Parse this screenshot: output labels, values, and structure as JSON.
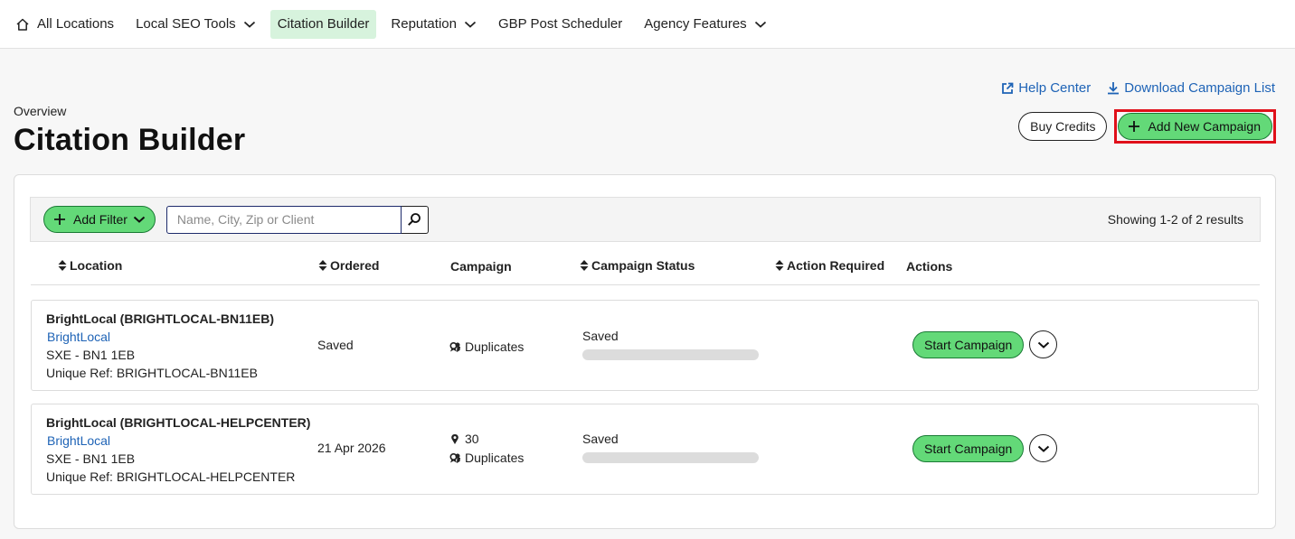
{
  "nav": {
    "items": [
      {
        "label": "All Locations",
        "icon": "home-icon"
      },
      {
        "label": "Local SEO Tools",
        "icon": "chevron-down-icon"
      },
      {
        "label": "Citation Builder"
      },
      {
        "label": "Reputation",
        "icon": "chevron-down-icon"
      },
      {
        "label": "GBP Post Scheduler"
      },
      {
        "label": "Agency Features",
        "icon": "chevron-down-icon"
      }
    ],
    "active": "Citation Builder"
  },
  "header": {
    "overview": "Overview",
    "title": "Citation Builder",
    "help_center": "Help Center",
    "download_list": "Download Campaign List",
    "buy_credits": "Buy Credits",
    "add_campaign": "Add New Campaign"
  },
  "filters": {
    "add_filter": "Add Filter",
    "search_placeholder": "Name, City, Zip or Client",
    "results": "Showing 1-2 of 2 results"
  },
  "table": {
    "columns": [
      "Location",
      "Ordered",
      "Campaign",
      "Campaign Status",
      "Action Required",
      "Actions"
    ],
    "rows": [
      {
        "name": "BrightLocal (BRIGHTLOCAL-BN11EB)",
        "client": "BrightLocal",
        "area": "SXE - BN1 1EB",
        "ref": "Unique Ref: BRIGHTLOCAL-BN11EB",
        "ordered": "Saved",
        "campaign_count": "",
        "campaign_dupes": "Duplicates",
        "status": "Saved",
        "progress": 0,
        "action_required": "",
        "action_button": "Start Campaign"
      },
      {
        "name": "BrightLocal (BRIGHTLOCAL-HELPCENTER)",
        "client": "BrightLocal",
        "area": "SXE - BN1 1EB",
        "ref": "Unique Ref: BRIGHTLOCAL-HELPCENTER",
        "ordered": "21 Apr 2026",
        "campaign_count": "30",
        "campaign_dupes": "Duplicates",
        "status": "Saved",
        "progress": 0,
        "action_required": "",
        "action_button": "Start Campaign"
      }
    ]
  },
  "colors": {
    "accent_green": "#63d978",
    "active_nav_bg": "#d7f3dd",
    "link_blue": "#1e63b6",
    "highlight_red": "#e0101a"
  }
}
